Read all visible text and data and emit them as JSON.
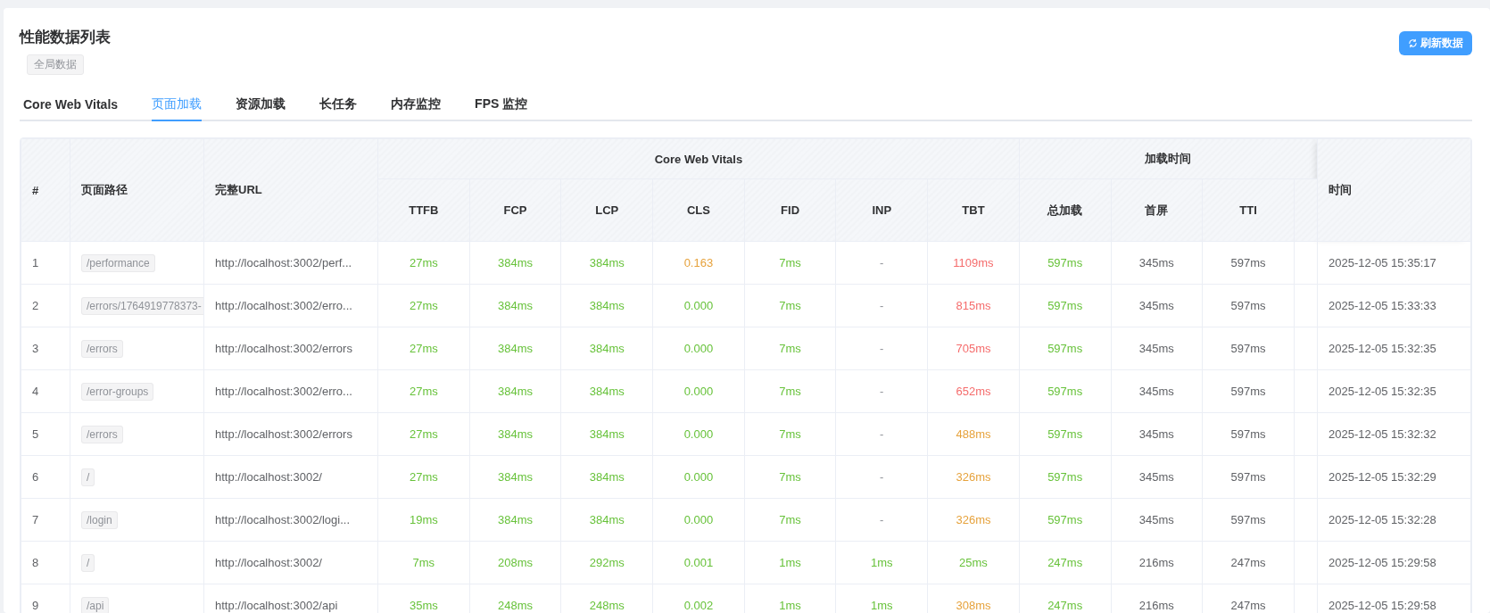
{
  "title": "性能数据列表",
  "scope_tag": "全局数据",
  "refresh_button": "刷新数据",
  "tabs": [
    {
      "label": "Core Web Vitals",
      "selected": false
    },
    {
      "label": "页面加载",
      "selected": true
    },
    {
      "label": "资源加载",
      "selected": false
    },
    {
      "label": "长任务",
      "selected": false
    },
    {
      "label": "内存监控",
      "selected": false
    },
    {
      "label": "FPS 监控",
      "selected": false
    }
  ],
  "table": {
    "columns": {
      "index": "#",
      "path": "页面路径",
      "url": "完整URL",
      "time": "时间"
    },
    "groups": [
      {
        "label": "Core Web Vitals",
        "metrics": [
          "TTFB",
          "FCP",
          "LCP",
          "CLS",
          "FID",
          "INP",
          "TBT"
        ]
      },
      {
        "label": "加载时间",
        "metrics": [
          "总加载",
          "首屏",
          "TTI"
        ]
      }
    ],
    "rows": [
      {
        "index": "1",
        "path": "/performance",
        "url": "http://localhost:3002/perf...",
        "metrics": [
          {
            "text": "27ms",
            "color": "#67c23a"
          },
          {
            "text": "384ms",
            "color": "#67c23a"
          },
          {
            "text": "384ms",
            "color": "#67c23a"
          },
          {
            "text": "0.163",
            "color": "#e6a23c"
          },
          {
            "text": "7ms",
            "color": "#67c23a"
          },
          {
            "text": "-"
          },
          {
            "text": "1109ms",
            "color": "#f56c6c"
          },
          {
            "text": "597ms",
            "color": "#67c23a"
          },
          {
            "text": "345ms",
            "color": "#606266"
          },
          {
            "text": "597ms",
            "color": "#606266"
          }
        ],
        "time": "2025-12-05 15:35:17"
      },
      {
        "index": "2",
        "path": "/errors/1764919778373-",
        "url": "http://localhost:3002/erro...",
        "metrics": [
          {
            "text": "27ms",
            "color": "#67c23a"
          },
          {
            "text": "384ms",
            "color": "#67c23a"
          },
          {
            "text": "384ms",
            "color": "#67c23a"
          },
          {
            "text": "0.000",
            "color": "#67c23a"
          },
          {
            "text": "7ms",
            "color": "#67c23a"
          },
          {
            "text": "-"
          },
          {
            "text": "815ms",
            "color": "#f56c6c"
          },
          {
            "text": "597ms",
            "color": "#67c23a"
          },
          {
            "text": "345ms",
            "color": "#606266"
          },
          {
            "text": "597ms",
            "color": "#606266"
          }
        ],
        "time": "2025-12-05 15:33:33"
      },
      {
        "index": "3",
        "path": "/errors",
        "url": "http://localhost:3002/errors",
        "metrics": [
          {
            "text": "27ms",
            "color": "#67c23a"
          },
          {
            "text": "384ms",
            "color": "#67c23a"
          },
          {
            "text": "384ms",
            "color": "#67c23a"
          },
          {
            "text": "0.000",
            "color": "#67c23a"
          },
          {
            "text": "7ms",
            "color": "#67c23a"
          },
          {
            "text": "-"
          },
          {
            "text": "705ms",
            "color": "#f56c6c"
          },
          {
            "text": "597ms",
            "color": "#67c23a"
          },
          {
            "text": "345ms",
            "color": "#606266"
          },
          {
            "text": "597ms",
            "color": "#606266"
          }
        ],
        "time": "2025-12-05 15:32:35"
      },
      {
        "index": "4",
        "path": "/error-groups",
        "url": "http://localhost:3002/erro...",
        "metrics": [
          {
            "text": "27ms",
            "color": "#67c23a"
          },
          {
            "text": "384ms",
            "color": "#67c23a"
          },
          {
            "text": "384ms",
            "color": "#67c23a"
          },
          {
            "text": "0.000",
            "color": "#67c23a"
          },
          {
            "text": "7ms",
            "color": "#67c23a"
          },
          {
            "text": "-"
          },
          {
            "text": "652ms",
            "color": "#f56c6c"
          },
          {
            "text": "597ms",
            "color": "#67c23a"
          },
          {
            "text": "345ms",
            "color": "#606266"
          },
          {
            "text": "597ms",
            "color": "#606266"
          }
        ],
        "time": "2025-12-05 15:32:35"
      },
      {
        "index": "5",
        "path": "/errors",
        "url": "http://localhost:3002/errors",
        "metrics": [
          {
            "text": "27ms",
            "color": "#67c23a"
          },
          {
            "text": "384ms",
            "color": "#67c23a"
          },
          {
            "text": "384ms",
            "color": "#67c23a"
          },
          {
            "text": "0.000",
            "color": "#67c23a"
          },
          {
            "text": "7ms",
            "color": "#67c23a"
          },
          {
            "text": "-"
          },
          {
            "text": "488ms",
            "color": "#e6a23c"
          },
          {
            "text": "597ms",
            "color": "#67c23a"
          },
          {
            "text": "345ms",
            "color": "#606266"
          },
          {
            "text": "597ms",
            "color": "#606266"
          }
        ],
        "time": "2025-12-05 15:32:32"
      },
      {
        "index": "6",
        "path": "/",
        "url": "http://localhost:3002/",
        "metrics": [
          {
            "text": "27ms",
            "color": "#67c23a"
          },
          {
            "text": "384ms",
            "color": "#67c23a"
          },
          {
            "text": "384ms",
            "color": "#67c23a"
          },
          {
            "text": "0.000",
            "color": "#67c23a"
          },
          {
            "text": "7ms",
            "color": "#67c23a"
          },
          {
            "text": "-"
          },
          {
            "text": "326ms",
            "color": "#e6a23c"
          },
          {
            "text": "597ms",
            "color": "#67c23a"
          },
          {
            "text": "345ms",
            "color": "#606266"
          },
          {
            "text": "597ms",
            "color": "#606266"
          }
        ],
        "time": "2025-12-05 15:32:29"
      },
      {
        "index": "7",
        "path": "/login",
        "url": "http://localhost:3002/logi...",
        "metrics": [
          {
            "text": "19ms",
            "color": "#67c23a"
          },
          {
            "text": "384ms",
            "color": "#67c23a"
          },
          {
            "text": "384ms",
            "color": "#67c23a"
          },
          {
            "text": "0.000",
            "color": "#67c23a"
          },
          {
            "text": "7ms",
            "color": "#67c23a"
          },
          {
            "text": "-"
          },
          {
            "text": "326ms",
            "color": "#e6a23c"
          },
          {
            "text": "597ms",
            "color": "#67c23a"
          },
          {
            "text": "345ms",
            "color": "#606266"
          },
          {
            "text": "597ms",
            "color": "#606266"
          }
        ],
        "time": "2025-12-05 15:32:28"
      },
      {
        "index": "8",
        "path": "/",
        "url": "http://localhost:3002/",
        "metrics": [
          {
            "text": "7ms",
            "color": "#67c23a"
          },
          {
            "text": "208ms",
            "color": "#67c23a"
          },
          {
            "text": "292ms",
            "color": "#67c23a"
          },
          {
            "text": "0.001",
            "color": "#67c23a"
          },
          {
            "text": "1ms",
            "color": "#67c23a"
          },
          {
            "text": "1ms",
            "color": "#67c23a"
          },
          {
            "text": "25ms",
            "color": "#67c23a"
          },
          {
            "text": "247ms",
            "color": "#67c23a"
          },
          {
            "text": "216ms",
            "color": "#606266"
          },
          {
            "text": "247ms",
            "color": "#606266"
          }
        ],
        "time": "2025-12-05 15:29:58"
      },
      {
        "index": "9",
        "path": "/api",
        "url": "http://localhost:3002/api",
        "metrics": [
          {
            "text": "35ms",
            "color": "#67c23a"
          },
          {
            "text": "248ms",
            "color": "#67c23a"
          },
          {
            "text": "248ms",
            "color": "#67c23a"
          },
          {
            "text": "0.002",
            "color": "#67c23a"
          },
          {
            "text": "1ms",
            "color": "#67c23a"
          },
          {
            "text": "1ms",
            "color": "#67c23a"
          },
          {
            "text": "308ms",
            "color": "#e6a23c"
          },
          {
            "text": "247ms",
            "color": "#67c23a"
          },
          {
            "text": "216ms",
            "color": "#606266"
          },
          {
            "text": "247ms",
            "color": "#606266"
          }
        ],
        "time": "2025-12-05 15:29:58"
      }
    ]
  }
}
